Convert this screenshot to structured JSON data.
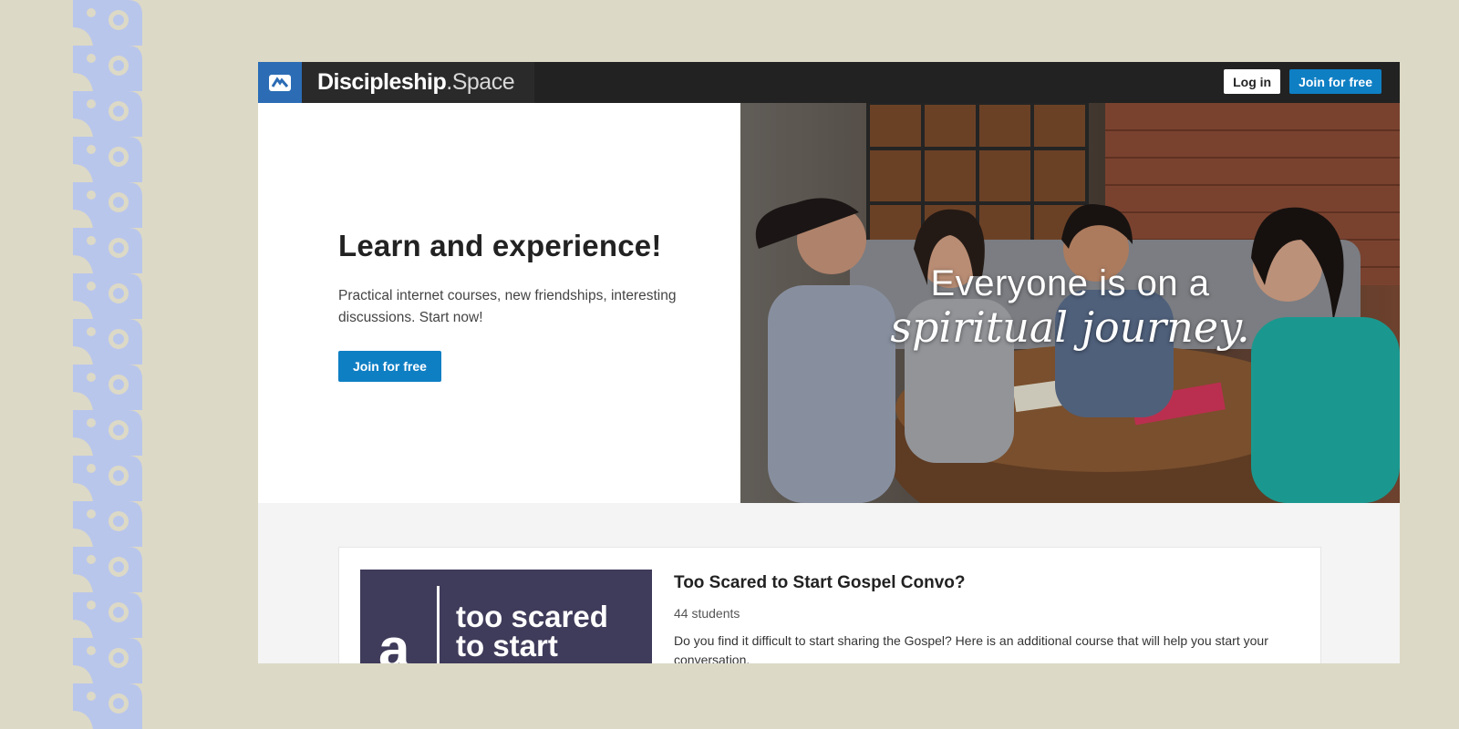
{
  "header": {
    "logo_icon": "discipleship-logo-icon",
    "brand_bold": "Discipleship",
    "brand_light": ".Space",
    "login_label": "Log in",
    "join_label": "Join for free"
  },
  "hero": {
    "title": "Learn and experience!",
    "text": "Practical internet courses, new friendships, interesting discussions. Start now!",
    "cta_label": "Join for free",
    "image_line1": "Everyone is on a",
    "image_line2": "spiritual journey."
  },
  "course": {
    "thumb_letter": "a",
    "thumb_text_line1": "too scared",
    "thumb_text_line2": "to start",
    "title": "Too Scared to Start Gospel Convo?",
    "students": "44 students",
    "description": "Do you find it difficult to start sharing the Gospel? Here is an additional course that will help you start your conversation."
  },
  "colors": {
    "background": "#dcd9c6",
    "topbar": "#222222",
    "accent": "#0f7fc4",
    "logo_blue": "#2b6cb5"
  }
}
